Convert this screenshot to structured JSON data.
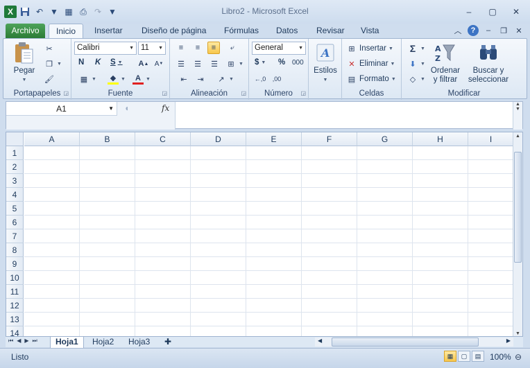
{
  "window": {
    "title": "Libro2 - Microsoft Excel",
    "minimize": "–",
    "maximize": "▢",
    "close": "✕"
  },
  "tabs": {
    "file": "Archivo",
    "items": [
      "Inicio",
      "Insertar",
      "Diseño de página",
      "Fórmulas",
      "Datos",
      "Revisar",
      "Vista"
    ],
    "active": "Inicio"
  },
  "ribbon": {
    "clipboard": {
      "paste": "Pegar",
      "group": "Portapapeles"
    },
    "font": {
      "name": "Calibri",
      "size": "11",
      "bold": "N",
      "italic": "K",
      "underline": "S",
      "group": "Fuente"
    },
    "alignment": {
      "group": "Alineación"
    },
    "number": {
      "format": "General",
      "currency": "$",
      "percent": "%",
      "thousands": "000",
      "group": "Número"
    },
    "styles": {
      "label": "Estilos"
    },
    "cells": {
      "insert": "Insertar",
      "delete": "Eliminar",
      "format": "Formato",
      "group": "Celdas"
    },
    "editing": {
      "sort_line1": "Ordenar",
      "sort_line2": "y filtrar",
      "find_line1": "Buscar y",
      "find_line2": "seleccionar",
      "group": "Modificar"
    }
  },
  "formula_bar": {
    "name_box": "A1",
    "fx": "fx",
    "content": ""
  },
  "grid": {
    "columns": [
      "A",
      "B",
      "C",
      "D",
      "E",
      "F",
      "G",
      "H",
      "I"
    ],
    "rows": [
      "1",
      "2",
      "3",
      "4",
      "5",
      "6",
      "7",
      "8",
      "9",
      "10",
      "11",
      "12",
      "13",
      "14"
    ]
  },
  "sheets": {
    "tabs": [
      "Hoja1",
      "Hoja2",
      "Hoja3"
    ],
    "active": "Hoja1"
  },
  "status": {
    "text": "Listo",
    "zoom": "100%"
  },
  "colors": {
    "accent_green": "#2a7a34",
    "ribbon_bg": "#dde8f4",
    "selection": "#f7c74c"
  }
}
